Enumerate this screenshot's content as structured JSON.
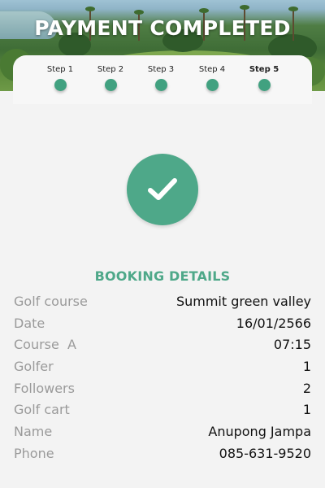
{
  "header": {
    "title": "PAYMENT COMPLETED"
  },
  "stepper": {
    "steps": [
      {
        "label": "Step 1"
      },
      {
        "label": "Step 2"
      },
      {
        "label": "Step 3"
      },
      {
        "label": "Step 4"
      },
      {
        "label": "Step 5"
      }
    ],
    "active_color": "#41a180"
  },
  "status_icon": "check-icon",
  "booking": {
    "section_title": "BOOKING DETAILS",
    "rows": [
      {
        "label": "Golf course",
        "value": "Summit green valley"
      },
      {
        "label": "Date",
        "value": "16/01/2566"
      },
      {
        "label": "Course  A",
        "value": "07:15"
      },
      {
        "label": "Golfer",
        "value": "1"
      },
      {
        "label": "Followers",
        "value": "2"
      },
      {
        "label": "Golf cart",
        "value": "1"
      },
      {
        "label": "Name",
        "value": "Anupong Jampa"
      },
      {
        "label": "Phone",
        "value": "085-631-9520"
      }
    ]
  },
  "colors": {
    "accent": "#4ea889",
    "label_gray": "#9a9a9a",
    "background": "#f3f3f3"
  }
}
